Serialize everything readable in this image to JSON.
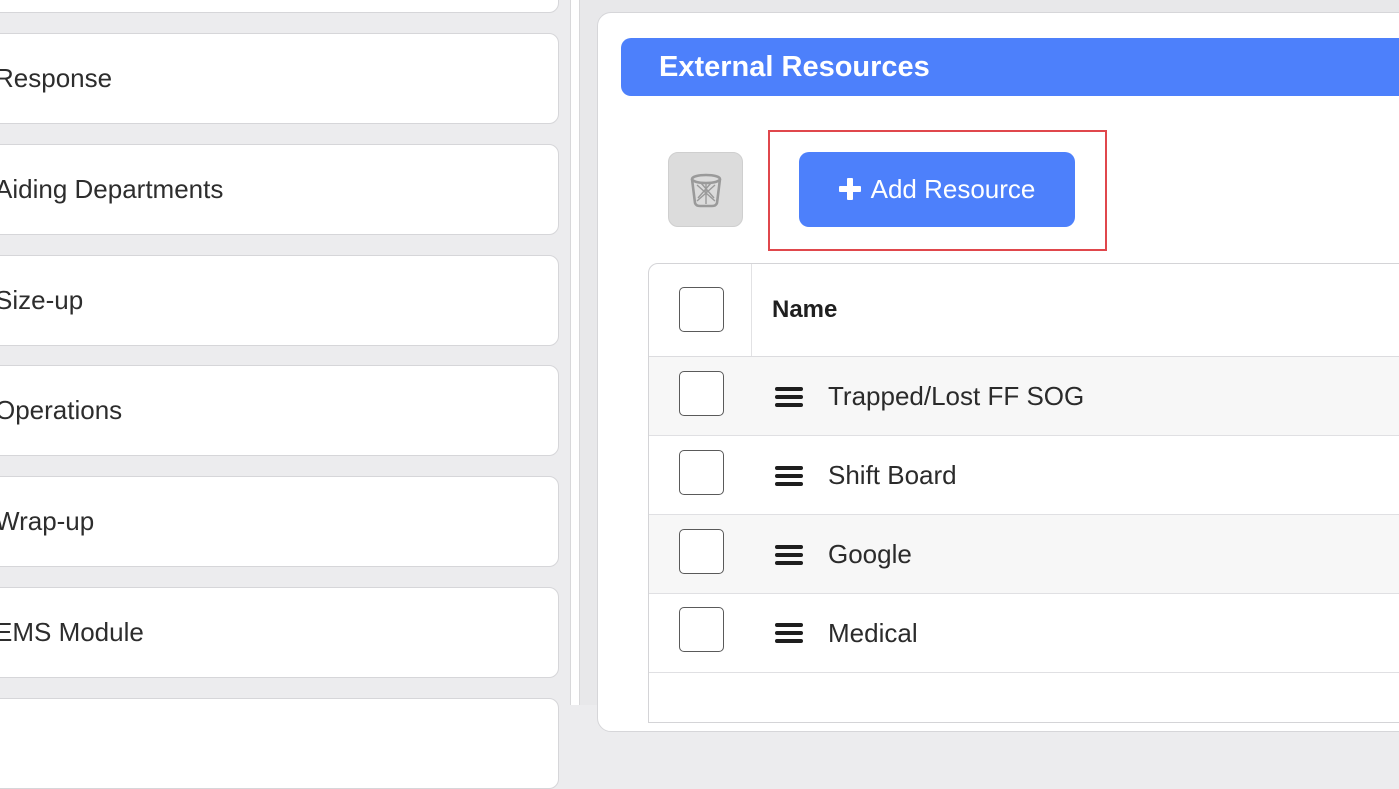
{
  "sidebar": {
    "items": [
      {
        "label": ""
      },
      {
        "label": "Response"
      },
      {
        "label": "Aiding Departments"
      },
      {
        "label": "Size-up"
      },
      {
        "label": "Operations"
      },
      {
        "label": "Wrap-up"
      },
      {
        "label": "EMS Module"
      },
      {
        "label": ""
      }
    ]
  },
  "section": {
    "title": "External Resources"
  },
  "toolbar": {
    "delete_icon": "trash-icon",
    "add_label": "Add Resource",
    "add_icon": "plus-icon"
  },
  "table": {
    "header_name": "Name",
    "rows": [
      {
        "name": "Trapped/Lost FF SOG"
      },
      {
        "name": "Shift Board"
      },
      {
        "name": "Google"
      },
      {
        "name": "Medical"
      }
    ]
  },
  "colors": {
    "accent": "#4d80fb",
    "highlight_border": "#e0474c",
    "page_bg": "#ececee"
  }
}
